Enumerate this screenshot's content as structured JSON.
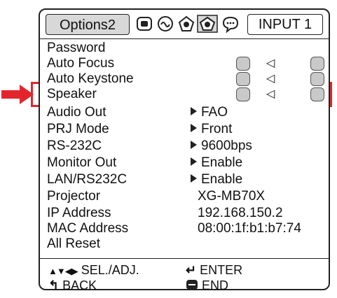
{
  "header": {
    "active_tab": "Options2",
    "tab_icons": [
      "picture-tab-icon",
      "sound-tab-icon",
      "options1-tab-icon",
      "options2-tab-icon",
      "language-tab-icon"
    ],
    "input_label": "INPUT 1"
  },
  "menu": {
    "rows": [
      {
        "label": "Password"
      },
      {
        "label": "Auto Focus"
      },
      {
        "label": "Auto Keystone"
      },
      {
        "label": "Speaker"
      },
      {
        "label": "Audio Out",
        "value": "FAO"
      },
      {
        "label": "PRJ Mode",
        "value": "Front"
      },
      {
        "label": "RS-232C",
        "value": "9600bps"
      },
      {
        "label": "Monitor Out",
        "value": "Enable"
      },
      {
        "label": "LAN/RS232C",
        "value": "Enable"
      },
      {
        "label": "Projector",
        "value": "XG-MB70X"
      },
      {
        "label": "IP Address",
        "value": "192.168.150.2"
      },
      {
        "label": "MAC Address",
        "value": "08:00:1f:b1:b7:74"
      },
      {
        "label": "All Reset"
      }
    ],
    "highlighted_row": "Speaker"
  },
  "help": {
    "sel_adj": "SEL./ADJ.",
    "enter": "ENTER",
    "back": "BACK",
    "end": "END"
  },
  "colors": {
    "highlight": "#e2252c",
    "toggle_fill": "#c9c9c9",
    "tab_fill": "#d8d8d8"
  }
}
